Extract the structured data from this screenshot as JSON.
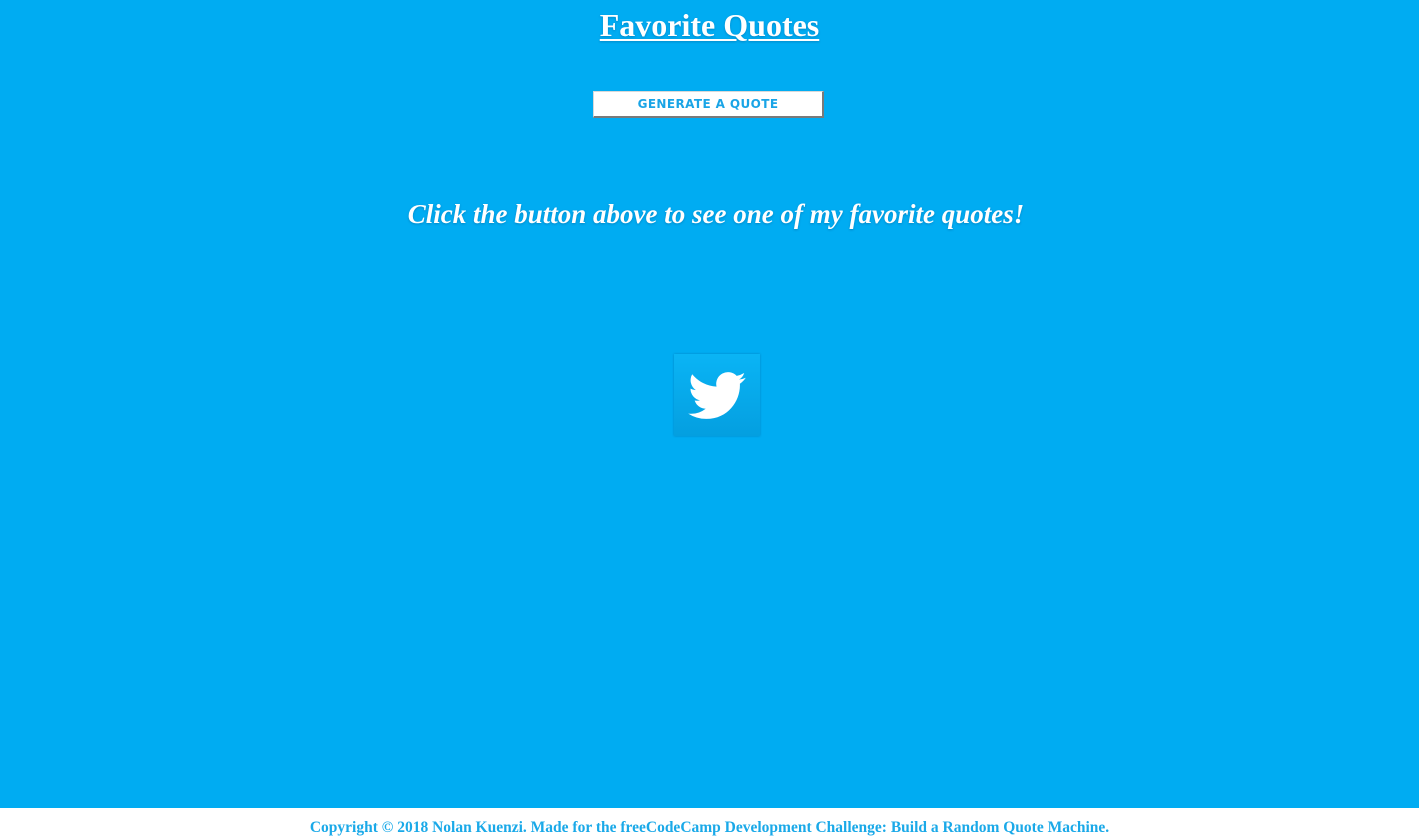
{
  "header": {
    "title": "Favorite Quotes"
  },
  "actions": {
    "generate_label": "GENERATE A QUOTE",
    "tweet_icon": "twitter-bird-icon"
  },
  "quote": {
    "prompt": "Click the button above to see one of my favorite quotes!"
  },
  "footer": {
    "copyright": "Copyright © 2018 Nolan Kuenzi. Made for the freeCodeCamp Development Challenge: Build a Random Quote Machine."
  },
  "colors": {
    "background": "#00acf2",
    "footer_background": "#ffffff",
    "accent_text": "#1aa9e8",
    "title_text": "#ffffff"
  }
}
